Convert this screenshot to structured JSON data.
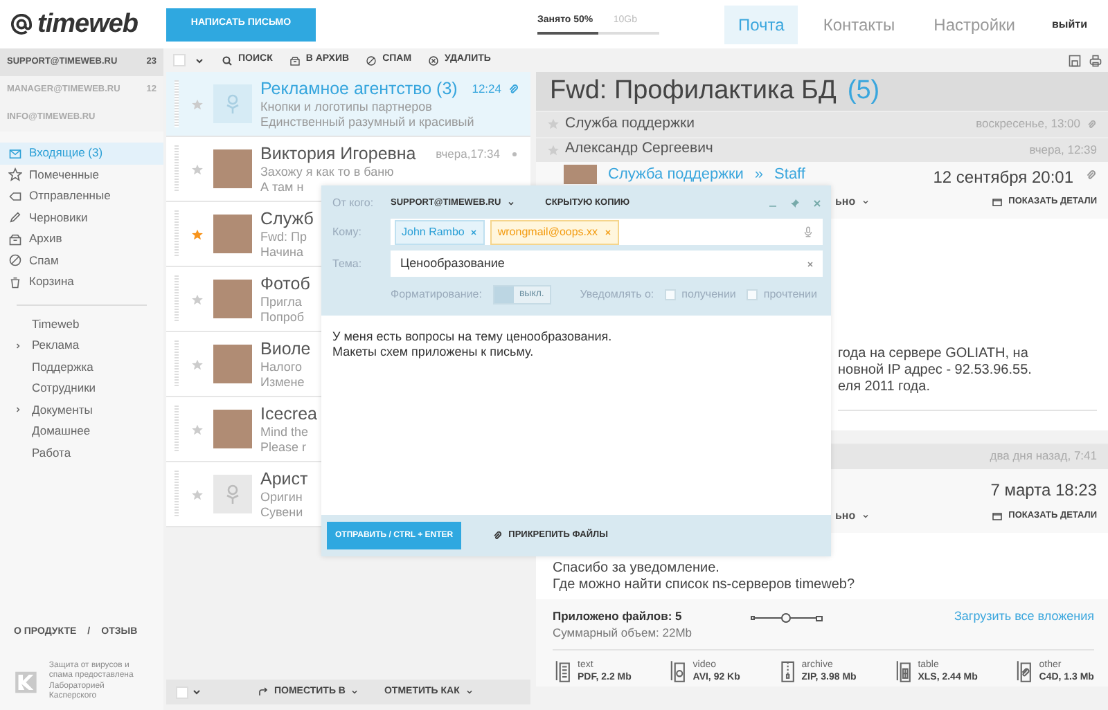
{
  "header": {
    "logo": "timeweb",
    "compose_button": "НАПИСАТЬ ПИСЬМО",
    "storage": {
      "label": "Занято",
      "percent": "50%",
      "total": "10Gb",
      "level": 0.5
    },
    "nav_tabs": [
      {
        "label": "Почта",
        "selected": true
      },
      {
        "label": "Контакты",
        "selected": false
      },
      {
        "label": "Настройки",
        "selected": false
      }
    ],
    "logout": "выйти"
  },
  "sidebar": {
    "accounts": [
      {
        "address": "SUPPORT@TIMEWEB.RU",
        "count": "23",
        "selected": true
      },
      {
        "address": "MANAGER@TIMEWEB.RU",
        "count": "12",
        "selected": false
      },
      {
        "address": "INFO@TIMEWEB.RU",
        "selected": false
      }
    ],
    "folders": [
      {
        "kind": "inbox",
        "label": "Входящие (3)",
        "selected": true
      },
      {
        "kind": "starred",
        "label": "Помеченные",
        "selected": false
      },
      {
        "kind": "sent",
        "label": "Отправленные",
        "selected": false
      },
      {
        "kind": "drafts",
        "label": "Черновики",
        "selected": false
      },
      {
        "kind": "archive",
        "label": "Архив",
        "selected": false
      },
      {
        "kind": "spam",
        "label": "Спам",
        "selected": false
      },
      {
        "kind": "trash",
        "label": "Корзина",
        "selected": false
      }
    ],
    "labels": [
      {
        "label": "Timeweb",
        "collapsed": false
      },
      {
        "label": "Реклама",
        "collapsed": true
      },
      {
        "label": "Поддержка",
        "collapsed": false
      },
      {
        "label": "Сотрудники",
        "collapsed": false
      },
      {
        "label": "Документы",
        "collapsed": true
      },
      {
        "label": "Домашнее",
        "collapsed": false
      },
      {
        "label": "Работа",
        "collapsed": false
      }
    ],
    "footer": {
      "links": [
        "О ПРОДУКТЕ",
        "ОТЗЫВ"
      ],
      "separator": "/",
      "antivirus_note": "Защита от вирусов  и спама предоставлена Лабораторией Касперского"
    }
  },
  "message_list": {
    "select_all": {
      "checked": false
    },
    "toolbar": [
      {
        "kind": "search",
        "label": "ПОИСК"
      },
      {
        "kind": "archive",
        "label": "В АРХИВ"
      },
      {
        "kind": "spam",
        "label": "СПАМ"
      },
      {
        "kind": "delete",
        "label": "УДАЛИТЬ"
      }
    ],
    "messages": [
      {
        "sender": "Рекламное агентство (3)",
        "time": "12:24",
        "attachment": true,
        "unread_dot": false,
        "selected": true,
        "starred": false,
        "kind": "placeholder",
        "preview": [
          "Кнопки и логотипы партнеров",
          "Единственный разумный и красивый"
        ]
      },
      {
        "sender": "Виктория Игоревна",
        "time": "вчера,17:34",
        "attachment": false,
        "unread_dot": true,
        "selected": false,
        "starred": false,
        "kind": "photo",
        "preview": [
          "Захожу я как то в баню",
          "А там н"
        ]
      },
      {
        "sender": "Служб",
        "selected": false,
        "starred": true,
        "kind": "photo",
        "preview": [
          "Fwd: Пр",
          "Начина"
        ]
      },
      {
        "sender": "Фотоб",
        "selected": false,
        "starred": false,
        "kind": "photo",
        "preview": [
          "Пригла",
          "Попроб"
        ]
      },
      {
        "sender": "Виоле",
        "selected": false,
        "starred": false,
        "kind": "photo",
        "preview": [
          "Налого",
          "Измене"
        ]
      },
      {
        "sender": "Icecrea",
        "selected": false,
        "starred": false,
        "kind": "photo",
        "preview": [
          "Mind the",
          "Please r"
        ]
      },
      {
        "sender": "Арист",
        "selected": false,
        "starred": false,
        "kind": "placeholder",
        "preview": [
          "Оригин",
          "Сувени"
        ]
      }
    ],
    "bottom_bar": {
      "select_all": {
        "checked": false
      },
      "actions": [
        "ПОМЕСТИТЬ В",
        "ОТМЕТИТЬ КАК"
      ]
    }
  },
  "reader": {
    "title": "Fwd: Профилактика БД",
    "count": "(5)",
    "thread": [
      {
        "kind": "collapsed",
        "sender": "Служба поддержки",
        "date": "воскресенье, 13:00",
        "attachment": true,
        "starred": false
      },
      {
        "kind": "collapsed",
        "sender": "Александр Сергеевич",
        "date": "вчера, 12:39",
        "attachment": false,
        "starred": false
      },
      {
        "kind": "expanded",
        "from": "Служба поддержки",
        "separator": "»",
        "to": "Staff",
        "date": "12 сентября 20:01",
        "attachment": true,
        "recipients": "ьно",
        "details": "ПОКАЗАТЬ ДЕТАЛИ",
        "body": [
          "года на сервере GOLIATH, на",
          "новной IP адрес - 92.53.96.55.",
          "еля 2011 года."
        ]
      },
      {
        "kind": "collapsed",
        "date": "два дня назад, 7:41",
        "attachment": false
      },
      {
        "kind": "expanded",
        "date": "7 марта 18:23",
        "attachment": false,
        "recipients": "ьно",
        "details": "ПОКАЗАТЬ ДЕТАЛИ",
        "body": [
          "Спасибо за уведомление.",
          "Где можно найти список ns-серверов timeweb?"
        ]
      }
    ],
    "attachments": {
      "count_label": "Приложено файлов: 5",
      "size_label": "Суммарный объем: 22Mb",
      "preview_size": {
        "level": 0.5
      },
      "download_all": "Загрузить все вложения",
      "files": [
        {
          "kind": "text",
          "label": "text",
          "info": "PDF, 2.2 Mb"
        },
        {
          "kind": "video",
          "label": "video",
          "info": "AVI, 92 Kb"
        },
        {
          "kind": "archive",
          "label": "archive",
          "info": "ZIP, 3.98 Mb"
        },
        {
          "kind": "table",
          "label": "table",
          "info": "XLS, 2.44 Mb"
        },
        {
          "kind": "other",
          "label": "other",
          "info": "C4D, 1.3 Mb"
        }
      ]
    }
  },
  "compose": {
    "from_label": "От кого:",
    "from": "SUPPORT@TIMEWEB.RU",
    "bcc": "СКРЫТУЮ КОПИЮ",
    "to_label": "Кому:",
    "recipients": [
      {
        "name": "John Rambo",
        "kind": "valid"
      },
      {
        "name": "wrongmail@oops.xx",
        "kind": "invalid"
      }
    ],
    "subject_label": "Тема:",
    "subject": "Ценообразование",
    "formatting_label": "Форматирование:",
    "formatting": {
      "on": false,
      "label": "выкл."
    },
    "notify_label": "Уведомлять о:",
    "notify": [
      {
        "label": "получении",
        "checked": false
      },
      {
        "label": "прочтении",
        "checked": false
      }
    ],
    "body": [
      "У меня есть вопросы на тему ценообразования.",
      "Макеты схем приложены к письму."
    ],
    "send": "ОТПРАВИТЬ / CTRL + ENTER",
    "attach": "ПРИКРЕПИТЬ ФАЙЛЫ"
  }
}
